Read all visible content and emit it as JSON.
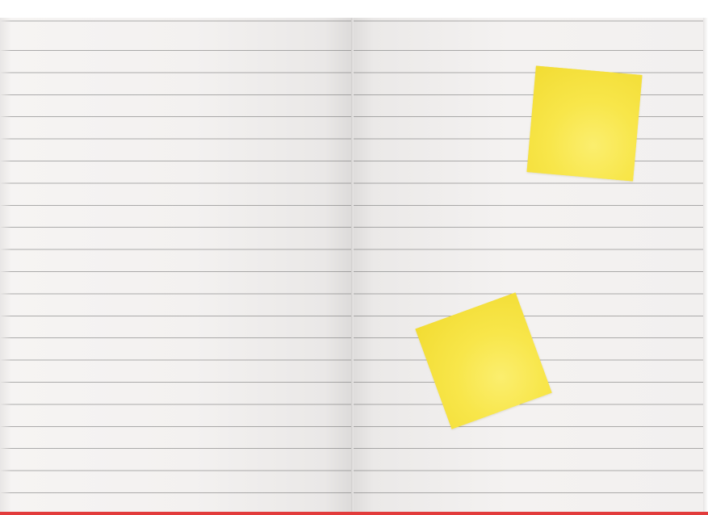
{
  "scene": {
    "subject": "open-lined-notebook",
    "colors": {
      "paper": "#f4f2f1",
      "ruling": "#6e6e6e",
      "sticky_note": "#f8e64a",
      "cover_edge": "#e23b3b",
      "background": "#ffffff"
    },
    "sticky_notes": [
      {
        "id": "upper-right",
        "color": "#f8e64a"
      },
      {
        "id": "lower-middle",
        "color": "#f8e64a"
      }
    ]
  }
}
